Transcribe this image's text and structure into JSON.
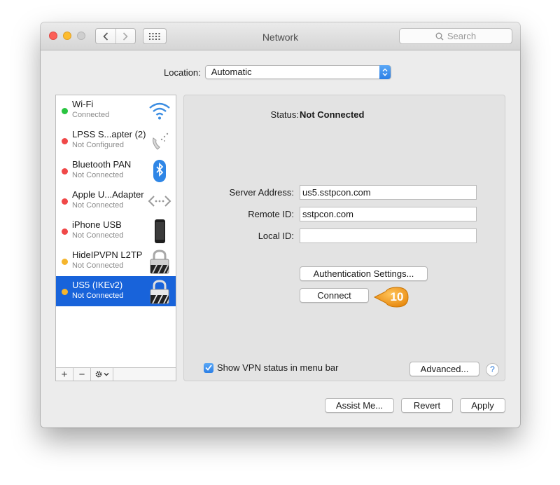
{
  "window": {
    "title": "Network",
    "search_placeholder": "Search"
  },
  "location": {
    "label": "Location:",
    "value": "Automatic"
  },
  "services": [
    {
      "name": "Wi-Fi",
      "status": "Connected",
      "dot_color": "#29c440",
      "icon": "wifi-icon"
    },
    {
      "name": "LPSS S...apter (2)",
      "status": "Not Configured",
      "dot_color": "#f04848",
      "icon": "phone-handset-icon"
    },
    {
      "name": "Bluetooth PAN",
      "status": "Not Connected",
      "dot_color": "#f04848",
      "icon": "bluetooth-icon"
    },
    {
      "name": "Apple U...Adapter",
      "status": "Not Connected",
      "dot_color": "#f04848",
      "icon": "ethernet-arrows-icon"
    },
    {
      "name": "iPhone USB",
      "status": "Not Connected",
      "dot_color": "#f04848",
      "icon": "iphone-icon"
    },
    {
      "name": "HideIPVPN L2TP",
      "status": "Not Connected",
      "dot_color": "#f5b52d",
      "icon": "vpn-lock-icon"
    },
    {
      "name": "US5 (IKEv2)",
      "status": "Not Connected",
      "dot_color": "#f5b52d",
      "icon": "vpn-lock-icon",
      "selected": true
    }
  ],
  "sidebar_tools": {
    "add": "+",
    "remove": "−"
  },
  "detail": {
    "status_label": "Status:",
    "status_value": "Not Connected",
    "server_address_label": "Server Address:",
    "server_address_value": "us5.sstpcon.com",
    "remote_id_label": "Remote ID:",
    "remote_id_value": "sstpcon.com",
    "local_id_label": "Local ID:",
    "local_id_value": "",
    "auth_button": "Authentication Settings...",
    "connect_button": "Connect",
    "step_badge": "10",
    "show_vpn_label": "Show VPN status in menu bar",
    "show_vpn_checked": true,
    "advanced_button": "Advanced...",
    "help": "?"
  },
  "footer": {
    "assist_button": "Assist Me...",
    "revert_button": "Revert",
    "apply_button": "Apply"
  },
  "colors": {
    "selection": "#1863da",
    "accent": "#2b7fe6",
    "badge": "#f39a1e"
  }
}
